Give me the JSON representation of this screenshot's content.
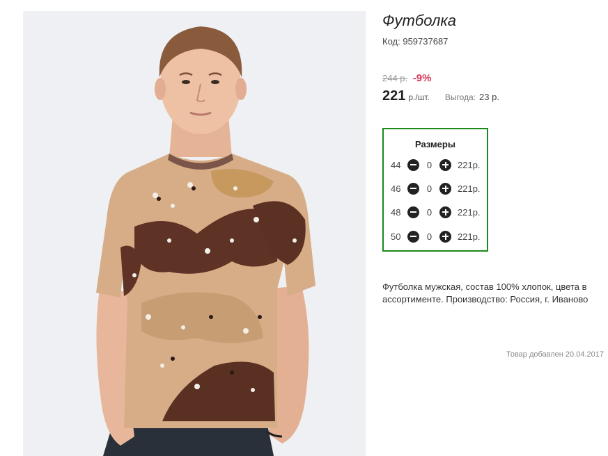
{
  "product": {
    "title": "Футболка",
    "code_label": "Код:",
    "code_value": "959737687",
    "old_price": "244 р.",
    "discount": "-9%",
    "price": "221",
    "price_unit": "р./шт.",
    "savings_label": "Выгода:",
    "savings_value": "23 р.",
    "description": "Футболка мужская, состав 100% хлопок, цвета в ассортименте. Производство: Россия, г. Иваново",
    "added_date": "Товар добавлен 20.04.2017"
  },
  "sizes": {
    "title": "Размеры",
    "rows": [
      {
        "size": "44",
        "qty": "0",
        "price": "221р."
      },
      {
        "size": "46",
        "qty": "0",
        "price": "221р."
      },
      {
        "size": "48",
        "qty": "0",
        "price": "221р."
      },
      {
        "size": "50",
        "qty": "0",
        "price": "221р."
      }
    ]
  },
  "icons": {
    "minus": "minus-circle-icon",
    "plus": "plus-circle-icon"
  },
  "colors": {
    "frame_border": "#1a8a1a",
    "discount": "#d9385a"
  }
}
